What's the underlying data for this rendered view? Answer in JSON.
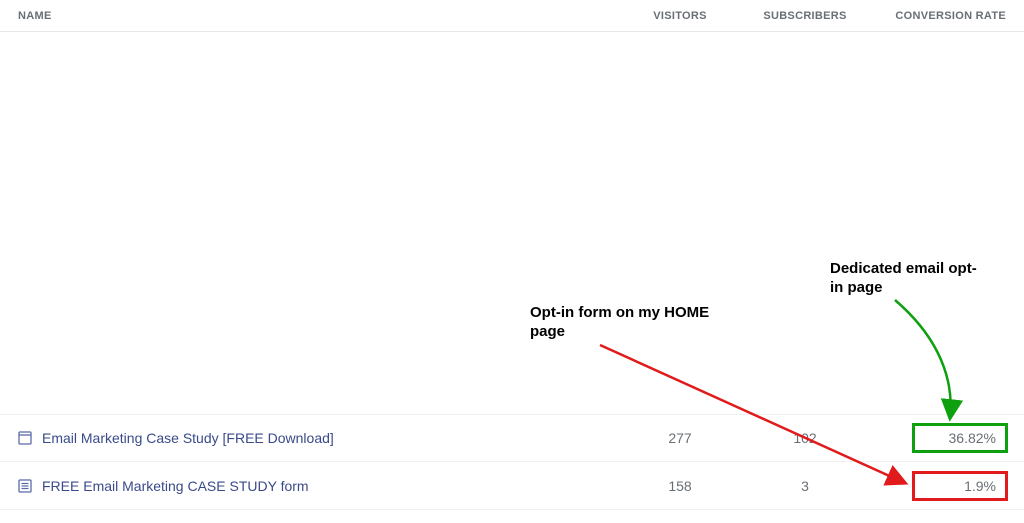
{
  "columns": {
    "name": "NAME",
    "visitors": "VISITORS",
    "subscribers": "SUBSCRIBERS",
    "conversion": "CONVERSION RATE"
  },
  "rows": [
    {
      "icon": "page-icon",
      "name": "Email Marketing Case Study [FREE Download]",
      "visitors": "277",
      "subscribers": "102",
      "conversion": "36.82%"
    },
    {
      "icon": "form-icon",
      "name": "FREE Email Marketing CASE STUDY form",
      "visitors": "158",
      "subscribers": "3",
      "conversion": "1.9%"
    }
  ],
  "annotations": {
    "opt_in_home": "Opt-in form on my HOME page",
    "dedicated_page": "Dedicated email opt-in page"
  },
  "colors": {
    "green": "#0ea00e",
    "red": "#e11b1b"
  }
}
